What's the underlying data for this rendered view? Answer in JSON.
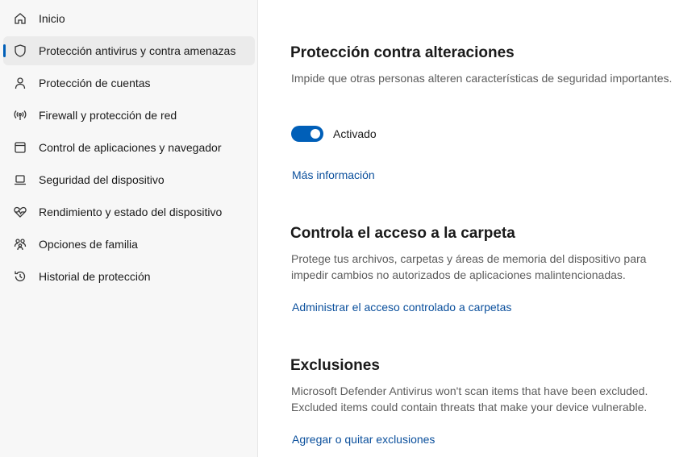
{
  "sidebar": {
    "items": [
      {
        "label": "Inicio",
        "icon": "home-icon"
      },
      {
        "label": "Protección antivirus y contra amenazas",
        "icon": "shield-icon",
        "active": true
      },
      {
        "label": "Protección de cuentas",
        "icon": "person-icon"
      },
      {
        "label": "Firewall y protección de red",
        "icon": "antenna-icon"
      },
      {
        "label": "Control de aplicaciones y navegador",
        "icon": "app-window-icon"
      },
      {
        "label": "Seguridad del dispositivo",
        "icon": "laptop-icon"
      },
      {
        "label": "Rendimiento y estado del dispositivo",
        "icon": "heart-pulse-icon"
      },
      {
        "label": "Opciones de familia",
        "icon": "family-icon"
      },
      {
        "label": "Historial de protección",
        "icon": "history-icon"
      }
    ]
  },
  "tamper": {
    "title": "Protección contra alteraciones",
    "description": "Impide que otras personas alteren características de seguridad importantes.",
    "toggle_label": "Activado",
    "toggle_on": true,
    "link": "Más información"
  },
  "folder_access": {
    "title": "Controla el acceso a la carpeta",
    "description": "Protege tus archivos, carpetas y áreas de memoria del dispositivo para impedir cambios no autorizados de aplicaciones malintencionadas.",
    "link": "Administrar el acceso controlado a carpetas"
  },
  "exclusions": {
    "title": "Exclusiones",
    "description": "Microsoft Defender Antivirus won't scan items that have been excluded. Excluded items could contain threats that make your device vulnerable.",
    "link": "Agregar o quitar exclusiones"
  },
  "colors": {
    "accent": "#005fb8",
    "link": "#0a4f9c",
    "sidebar_bg": "#f7f7f7"
  }
}
